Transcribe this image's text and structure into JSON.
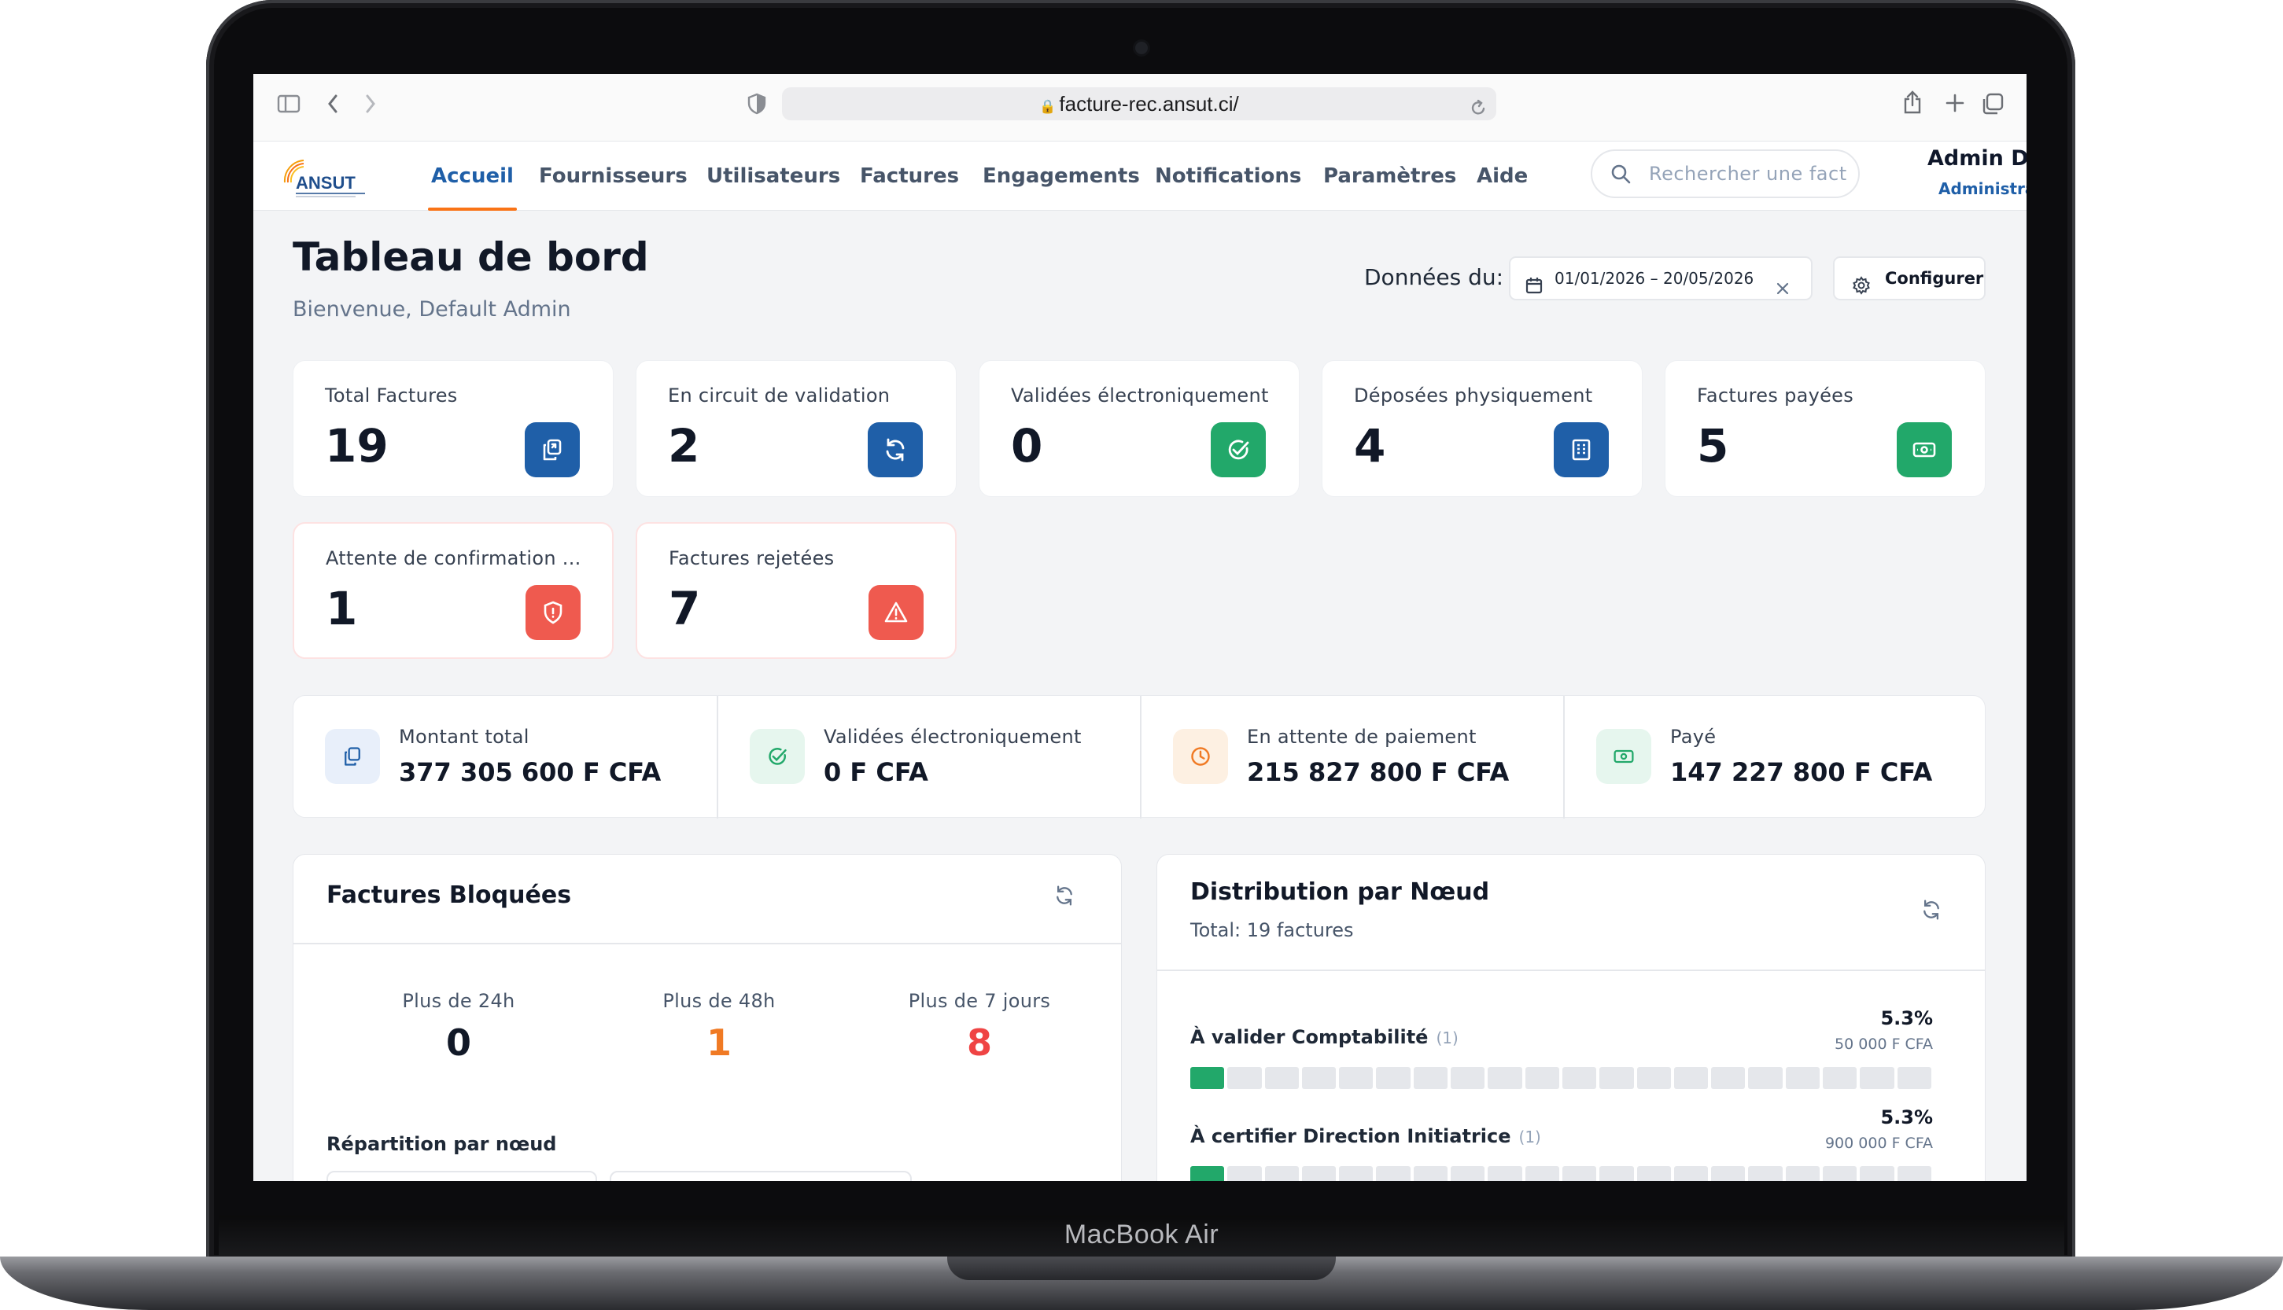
{
  "device": {
    "label": "MacBook Air"
  },
  "browser": {
    "url": "facture-rec.ansut.ci/"
  },
  "app": {
    "logo_text": "ANSUT",
    "nav": [
      "Accueil",
      "Fournisseurs",
      "Utilisateurs",
      "Factures",
      "Engagements",
      "Notifications",
      "Paramètres",
      "Aide"
    ],
    "active_nav": "Accueil",
    "search_placeholder": "Rechercher une fact",
    "user_name": "Admin De",
    "user_role": "Administra"
  },
  "dashboard": {
    "title": "Tableau de bord",
    "welcome": "Bienvenue, Default Admin",
    "date_label": "Données du:",
    "date_range": "01/01/2026 – 20/05/2026",
    "configure_label": "Configurer"
  },
  "stats": [
    {
      "label": "Total Factures",
      "value": "19",
      "icon": "copy-icon",
      "color": "#1f5fa8"
    },
    {
      "label": "En circuit de validation",
      "value": "2",
      "icon": "refresh-icon",
      "color": "#1f5fa8"
    },
    {
      "label": "Validées électroniquement",
      "value": "0",
      "icon": "check-circle-icon",
      "color": "#22a86a"
    },
    {
      "label": "Déposées physiquement",
      "value": "4",
      "icon": "building-icon",
      "color": "#1f5fa8"
    },
    {
      "label": "Factures payées",
      "value": "5",
      "icon": "banknote-icon",
      "color": "#22a86a"
    },
    {
      "label": "Attente de confirmation ...",
      "value": "1",
      "icon": "shield-alert-icon",
      "color": "#ef5a4f"
    },
    {
      "label": "Factures rejetées",
      "value": "7",
      "icon": "warning-triangle-icon",
      "color": "#ef5a4f"
    }
  ],
  "amounts": [
    {
      "label": "Montant total",
      "value": "377 305 600 F CFA",
      "icon": "copy-icon"
    },
    {
      "label": "Validées électroniquement",
      "value": "0 F CFA",
      "icon": "check-circle-icon"
    },
    {
      "label": "En attente de paiement",
      "value": "215 827 800 F CFA",
      "icon": "clock-icon"
    },
    {
      "label": "Payé",
      "value": "147 227 800 F CFA",
      "icon": "banknote-icon"
    }
  ],
  "blocked": {
    "title": "Factures Bloquées",
    "columns": [
      {
        "label": "Plus de 24h",
        "value": "0",
        "color": "#111827"
      },
      {
        "label": "Plus de 48h",
        "value": "1",
        "color": "#f07a24"
      },
      {
        "label": "Plus de 7 jours",
        "value": "8",
        "color": "#ef4444"
      }
    ],
    "breakdown_label": "Répartition par nœud"
  },
  "distribution": {
    "title": "Distribution par Nœud",
    "total": "Total: 19 factures",
    "rows": [
      {
        "name": "À valider Comptabilité",
        "count": "(1)",
        "percent": "5.3%",
        "amount": "50 000 F CFA",
        "share": 0.053
      },
      {
        "name": "À certifier Direction Initiatrice",
        "count": "(1)",
        "percent": "5.3%",
        "amount": "900 000 F CFA",
        "share": 0.053
      }
    ]
  }
}
